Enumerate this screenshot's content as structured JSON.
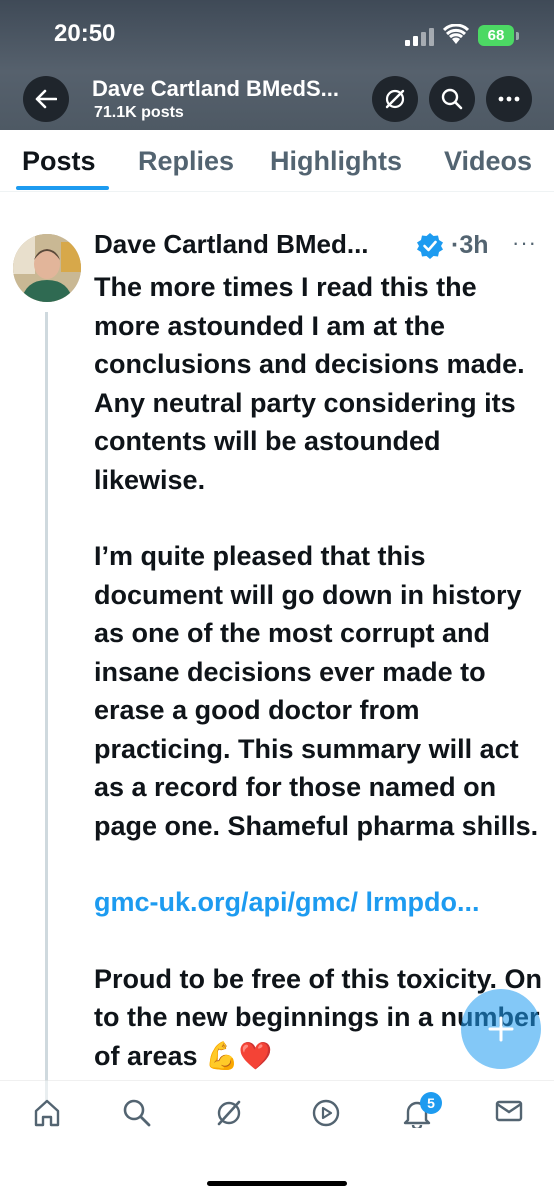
{
  "status_bar": {
    "time": "20:50",
    "battery": "68"
  },
  "header": {
    "account_name": "Dave Cartland BMedS...",
    "posts_count": "71.1K posts",
    "icons": [
      "back-arrow-icon",
      "grok-icon",
      "search-icon",
      "more-icon"
    ]
  },
  "tabs": [
    {
      "label": "Posts",
      "active": true
    },
    {
      "label": "Replies",
      "active": false
    },
    {
      "label": "Highlights",
      "active": false
    },
    {
      "label": "Videos",
      "active": false
    }
  ],
  "post": {
    "author": "Dave Cartland BMed...",
    "time": "·3h",
    "more": "···",
    "para1": "The more times I read this the more astounded I am at the conclusions and decisions made. Any neutral party considering its contents will be astounded likewise.",
    "para2": "I’m quite pleased that this document will go down in history as one of the most corrupt and insane decisions ever made to erase a good doctor from practicing. This summary will act as a record for those named on page one. Shameful pharma shills.",
    "link": "gmc-uk.org/api/gmc/ lrmpdo...",
    "para3": "Proud to be free of this toxicity. On to the new beginnings in a number of areas 💪❤️"
  },
  "fab": {
    "label": "+"
  },
  "bottom_nav": {
    "items": [
      "home-icon",
      "search-icon",
      "grok-icon",
      "communities-icon",
      "notifications-icon",
      "messages-icon"
    ],
    "notification_badge": "5"
  },
  "colors": {
    "accent": "#1d9bf0",
    "text": "#0f1419",
    "secondary": "#536471"
  }
}
